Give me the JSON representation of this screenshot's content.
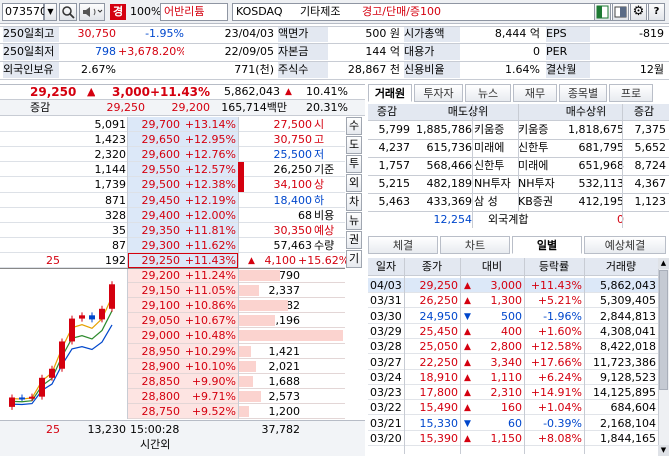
{
  "toolbar": {
    "code": "073570",
    "badge": "경",
    "zoom": "100%",
    "name": "어반리튬",
    "market": "KOSDAQ",
    "sector": "기타제조",
    "alert": "경고/단매/증100"
  },
  "info": {
    "rows": [
      {
        "l1": "250일최고",
        "v1": "30,750",
        "p1": "-1.95%",
        "d1": "23/04/03",
        "l2": "액면가",
        "v2": "500 원",
        "l3": "시가총액",
        "v3": "8,444 억",
        "l4": "EPS",
        "v4": "-819"
      },
      {
        "l1": "250일최저",
        "v1": "798",
        "p1": "+3,678.20%",
        "d1": "22/09/05",
        "l2": "자본금",
        "v2": "144 억",
        "l3": "대용가",
        "v3": "0",
        "l4": "PER",
        "v4": ""
      },
      {
        "l1": "외국인보유",
        "v1": "2.67%",
        "p1": "",
        "d1": "771(천)",
        "l2": "주식수",
        "v2": "28,867 천",
        "l3": "신용비율",
        "v3": "1.64%",
        "l4": "결산월",
        "v4": "12월"
      }
    ]
  },
  "quote": {
    "price": "29,250",
    "change": "3,000",
    "rate": "+11.43%",
    "volume": "5,862,043",
    "vrate": "10.41%",
    "sub": {
      "label": "증감",
      "ask": "29,250",
      "bid": "29,200",
      "amount": "165,714백만",
      "turn": "20.31%"
    }
  },
  "orderbook": {
    "asks": [
      {
        "qty": "5,091",
        "price": "29,700",
        "pct": "+13.14%"
      },
      {
        "qty": "1,423",
        "price": "29,650",
        "pct": "+12.95%"
      },
      {
        "qty": "2,320",
        "price": "29,600",
        "pct": "+12.76%"
      },
      {
        "qty": "1,144",
        "price": "29,550",
        "pct": "+12.57%"
      },
      {
        "qty": "1,739",
        "price": "29,500",
        "pct": "+12.38%"
      },
      {
        "qty": "871",
        "price": "29,450",
        "pct": "+12.19%"
      },
      {
        "qty": "328",
        "price": "29,400",
        "pct": "+12.00%"
      },
      {
        "qty": "35",
        "price": "29,350",
        "pct": "+11.81%"
      },
      {
        "qty": "87",
        "price": "29,300",
        "pct": "+11.62%"
      },
      {
        "qty": "192",
        "price": "29,250",
        "pct": "+11.43%",
        "chg": "25"
      }
    ],
    "bids": [
      {
        "qty": "4,790",
        "price": "29,200",
        "pct": "+11.24%"
      },
      {
        "qty": "2,337",
        "price": "29,150",
        "pct": "+11.05%"
      },
      {
        "qty": "5,682",
        "price": "29,100",
        "pct": "+10.86%"
      },
      {
        "qty": "4,196",
        "price": "29,050",
        "pct": "+10.67%"
      },
      {
        "qty": "11,874",
        "price": "29,000",
        "pct": "+10.48%"
      },
      {
        "qty": "1,421",
        "price": "28,950",
        "pct": "+10.29%"
      },
      {
        "qty": "2,021",
        "price": "28,900",
        "pct": "+10.10%"
      },
      {
        "qty": "1,688",
        "price": "28,850",
        "pct": "+9.90%"
      },
      {
        "qty": "2,573",
        "price": "28,800",
        "pct": "+9.71%"
      },
      {
        "qty": "1,200",
        "price": "28,750",
        "pct": "+9.52%"
      }
    ],
    "stats": [
      {
        "v": "27,500",
        "l": "시",
        "c": "r"
      },
      {
        "v": "30,750",
        "l": "고",
        "c": "r"
      },
      {
        "v": "25,500",
        "l": "저",
        "c": "b"
      },
      {
        "v": "26,250",
        "l": "기준",
        "c": "k"
      },
      {
        "v": "34,100",
        "l": "상",
        "c": "r"
      },
      {
        "v": "18,400",
        "l": "하",
        "c": "b"
      },
      {
        "v": "68",
        "l": "비용",
        "c": "k"
      },
      {
        "v": "30,350",
        "l": "예상",
        "c": "r"
      },
      {
        "v": "57,463",
        "l": "수량",
        "c": "k"
      }
    ],
    "expected": {
      "chg": "4,100",
      "pct": "+15.62%"
    },
    "footer": {
      "chg": "25",
      "total_ask": "13,230",
      "time": "15:00:28",
      "time_label": "시간외",
      "total_bid": "37,782"
    },
    "side_buttons": [
      "수",
      "도",
      "투",
      "외",
      "차",
      "뉴",
      "권",
      "기"
    ]
  },
  "broker": {
    "tabs": [
      "거래원",
      "투자자",
      "뉴스",
      "재무",
      "종목별",
      "프로"
    ],
    "headers": [
      "증감",
      "매도상위",
      "매수상위",
      "증감"
    ],
    "rows": [
      {
        "sv": "5,799",
        "sq": "1,885,786",
        "sn": "키움증",
        "bn": "키움증",
        "bq": "1,818,675",
        "bv": "7,375"
      },
      {
        "sv": "4,237",
        "sq": "615,736",
        "sn": "미래에",
        "bn": "신한투",
        "bq": "681,795",
        "bv": "5,652"
      },
      {
        "sv": "1,757",
        "sq": "568,466",
        "sn": "신한투",
        "bn": "미래에",
        "bq": "651,968",
        "bv": "8,724"
      },
      {
        "sv": "5,215",
        "sq": "482,189",
        "sn": "NH투자",
        "bn": "NH투자",
        "bq": "532,113",
        "bv": "4,367"
      },
      {
        "sv": "5,463",
        "sq": "433,369",
        "sn": "삼 성",
        "bn": "KB증권",
        "bq": "412,195",
        "bv": "1,123"
      }
    ],
    "foreign": {
      "v": "12,254",
      "label": "외국계합",
      "bv": "0"
    }
  },
  "daily": {
    "tabs": [
      "체결",
      "차트",
      "일별",
      "예상체결"
    ],
    "headers": [
      "일자",
      "종가",
      "대비",
      "등락률",
      "거래량"
    ],
    "rows": [
      {
        "d": "04/03",
        "c": "29,250",
        "a": "▲",
        "ch": "3,000",
        "p": "+11.43%",
        "v": "5,862,043",
        "cl": "r"
      },
      {
        "d": "03/31",
        "c": "26,250",
        "a": "▲",
        "ch": "1,300",
        "p": "+5.21%",
        "v": "5,309,405",
        "cl": "r"
      },
      {
        "d": "03/30",
        "c": "24,950",
        "a": "▼",
        "ch": "500",
        "p": "-1.96%",
        "v": "2,844,813",
        "cl": "b"
      },
      {
        "d": "03/29",
        "c": "25,450",
        "a": "▲",
        "ch": "400",
        "p": "+1.60%",
        "v": "4,308,041",
        "cl": "r"
      },
      {
        "d": "03/28",
        "c": "25,050",
        "a": "▲",
        "ch": "2,800",
        "p": "+12.58%",
        "v": "8,422,018",
        "cl": "r"
      },
      {
        "d": "03/27",
        "c": "22,250",
        "a": "▲",
        "ch": "3,340",
        "p": "+17.66%",
        "v": "11,723,386",
        "cl": "r"
      },
      {
        "d": "03/24",
        "c": "18,910",
        "a": "▲",
        "ch": "1,110",
        "p": "+6.24%",
        "v": "9,128,523",
        "cl": "r"
      },
      {
        "d": "03/23",
        "c": "17,800",
        "a": "▲",
        "ch": "2,310",
        "p": "+14.91%",
        "v": "14,125,895",
        "cl": "r"
      },
      {
        "d": "03/22",
        "c": "15,490",
        "a": "▲",
        "ch": "160",
        "p": "+1.04%",
        "v": "684,604",
        "cl": "r"
      },
      {
        "d": "03/21",
        "c": "15,330",
        "a": "▼",
        "ch": "60",
        "p": "-0.39%",
        "v": "2,168,104",
        "cl": "b"
      },
      {
        "d": "03/20",
        "c": "15,390",
        "a": "▲",
        "ch": "1,150",
        "p": "+8.08%",
        "v": "1,844,165",
        "cl": "r"
      }
    ]
  },
  "colors": {
    "up": "#d4000f",
    "down": "#0047cc",
    "ask_bg": "#dce8f8",
    "bid_bg": "#fde4e2",
    "header_bg": "#e3e8f1"
  }
}
